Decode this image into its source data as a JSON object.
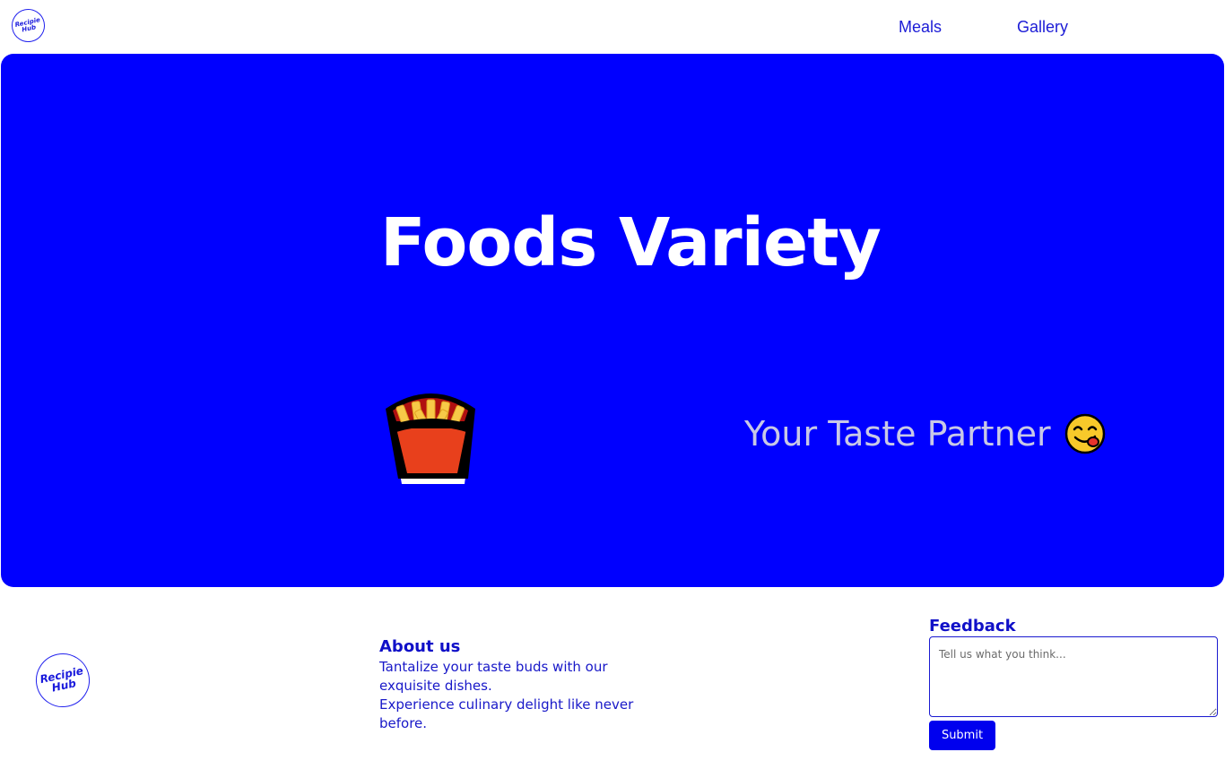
{
  "nav": {
    "logo_line1": "Recipie",
    "logo_line2": "Hub",
    "links": [
      {
        "label": "Meals"
      },
      {
        "label": "Gallery"
      }
    ]
  },
  "hero": {
    "title": "Foods Variety",
    "tagline": "Your Taste Partner",
    "fries_icon": "french-fries-icon",
    "smile_icon": "yum-face-icon",
    "background_color": "#0000ff"
  },
  "footer": {
    "logo_line1": "Recipie",
    "logo_line2": "Hub",
    "about": {
      "heading": "About us",
      "line1": "Tantalize your taste buds with our exquisite dishes.",
      "line2": "Experience culinary delight like never before."
    },
    "feedback": {
      "heading": "Feedback",
      "placeholder": "Tell us what you think...",
      "submit_label": "Submit"
    }
  }
}
